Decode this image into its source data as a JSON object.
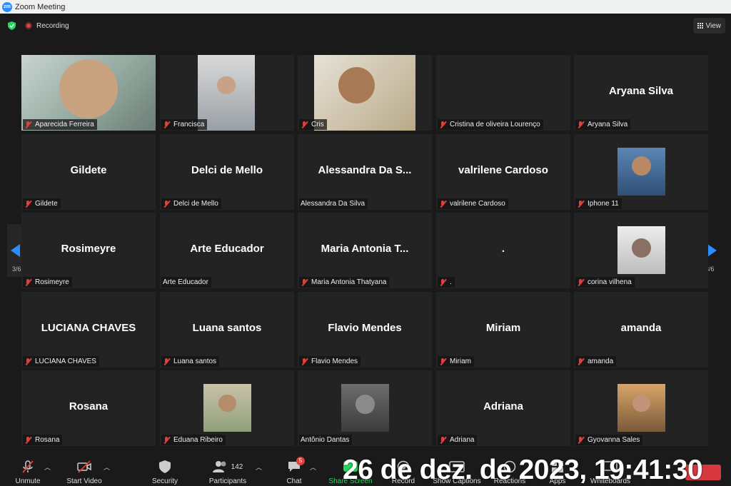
{
  "window": {
    "title": "Zoom Meeting",
    "logo": "zm"
  },
  "topbar": {
    "recording_label": "Recording",
    "view_label": "View"
  },
  "pagination": {
    "left": "3/6",
    "right": "3/6"
  },
  "tiles": [
    {
      "name": "Aparecida Ferreira",
      "display": "",
      "muted": true
    },
    {
      "name": "Francisca",
      "display": "",
      "muted": true
    },
    {
      "name": "Cris",
      "display": "",
      "muted": true
    },
    {
      "name": "Cristina  de oliveira Lourenço",
      "display": "",
      "muted": true
    },
    {
      "name": "Aryana Silva",
      "display": "Aryana Silva",
      "muted": true
    },
    {
      "name": "Gildete",
      "display": "Gildete",
      "muted": true
    },
    {
      "name": "Delci de Mello",
      "display": "Delci de Mello",
      "muted": true
    },
    {
      "name": "Alessandra Da Silva",
      "display": "Alessandra  Da  S...",
      "muted": false
    },
    {
      "name": "valrilene Cardoso",
      "display": "valrilene Cardoso",
      "muted": true
    },
    {
      "name": "Iphone 11",
      "display": "",
      "muted": true
    },
    {
      "name": "Rosimeyre",
      "display": "Rosimeyre",
      "muted": true
    },
    {
      "name": "Arte Educador",
      "display": "Arte Educador",
      "muted": false
    },
    {
      "name": "Maria Antonia Thatyana",
      "display": "Maria  Antonia  T...",
      "muted": true
    },
    {
      "name": ".",
      "display": ".",
      "muted": true
    },
    {
      "name": "corina vilhena",
      "display": "",
      "muted": true
    },
    {
      "name": "LUCIANA CHAVES",
      "display": "LUCIANA CHAVES",
      "muted": true
    },
    {
      "name": "Luana santos",
      "display": "Luana santos",
      "muted": true
    },
    {
      "name": "Flavio Mendes",
      "display": "Flavio Mendes",
      "muted": true
    },
    {
      "name": "Miriam",
      "display": "Miriam",
      "muted": true
    },
    {
      "name": "amanda",
      "display": "amanda",
      "muted": true
    },
    {
      "name": "Rosana",
      "display": "Rosana",
      "muted": true
    },
    {
      "name": "Eduana Ribeiro",
      "display": "",
      "muted": true
    },
    {
      "name": "Antônio Dantas",
      "display": "",
      "muted": false
    },
    {
      "name": "Adriana",
      "display": "Adriana",
      "muted": true
    },
    {
      "name": "Gyovanna Sales",
      "display": "",
      "muted": true
    }
  ],
  "toolbar": {
    "unmute": "Unmute",
    "start_video": "Start Video",
    "security": "Security",
    "participants": "Participants",
    "participants_count": "142",
    "chat": "Chat",
    "chat_badge": "5",
    "share_screen": "Share Screen",
    "record": "Record",
    "show_captions": "Show Captions",
    "reactions": "Reactions",
    "apps": "Apps",
    "whiteboards": "Whiteboards"
  },
  "timestamp": "26 de dez. de 2023, 19:41:30",
  "colors": {
    "accent": "#2d8cff",
    "muted_red": "#e0403a",
    "share_green": "#23d959",
    "end_red": "#d7373f"
  }
}
